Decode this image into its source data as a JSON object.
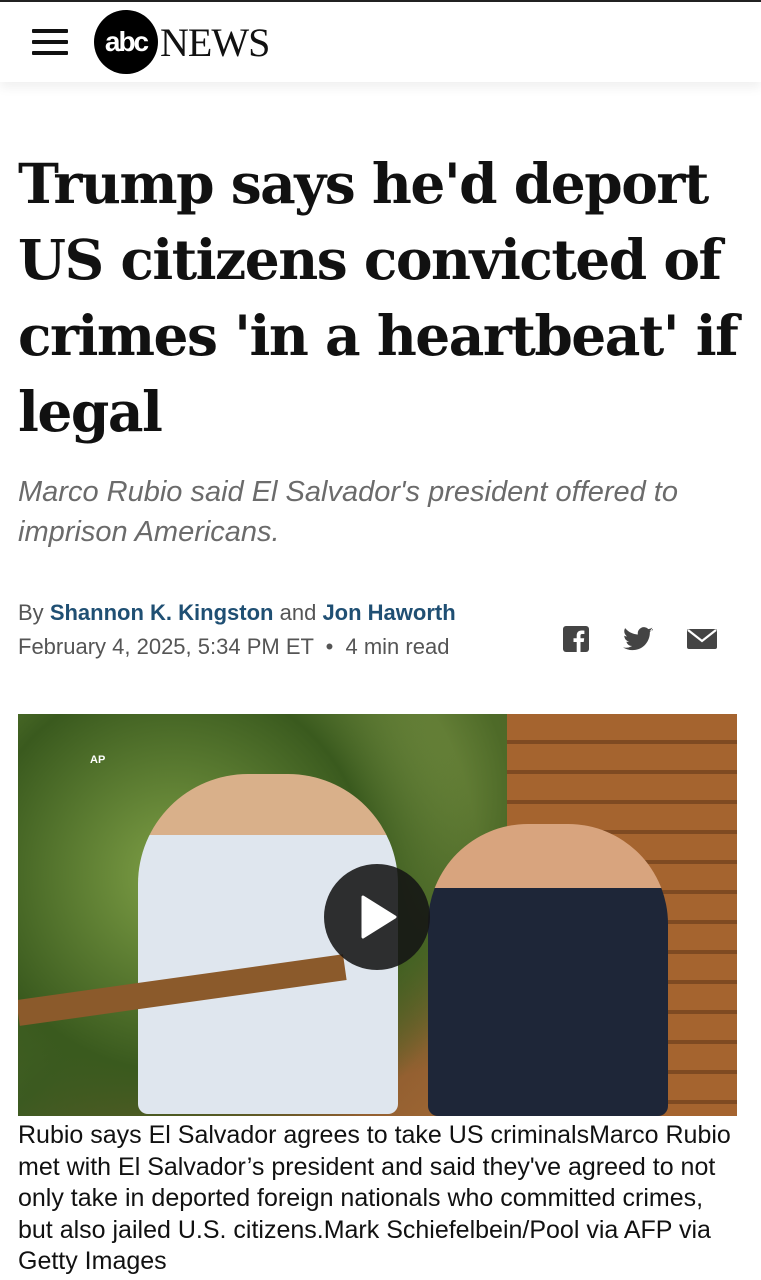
{
  "header": {
    "menu_icon": "hamburger-menu-icon",
    "logo_circle": "abc",
    "logo_text": "NEWS"
  },
  "article": {
    "headline": "Trump says he'd deport US citizens convicted of crimes 'in a heartbeat' if legal",
    "subheadline": "Marco Rubio said El Salvador's president offered to imprison Americans.",
    "byline": {
      "prefix": "By",
      "author1": "Shannon K. Kingston",
      "conjunction": "and",
      "author2": "Jon Haworth",
      "date": "February 4, 2025, 5:34 PM ET",
      "separator": "•",
      "read_time": "4 min read"
    },
    "share_icons": [
      "facebook-icon",
      "twitter-icon",
      "email-icon"
    ],
    "media": {
      "credit_tag": "AP",
      "play_icon": "play-icon",
      "caption": "Rubio says El Salvador agrees to take US criminalsMarco Rubio met with El Salvador’s president and said they've agreed to not only take in deported foreign nationals who committed crimes, but also jailed U.S. citizens.Mark Schiefelbein/Pool via AFP via Getty Images"
    }
  }
}
